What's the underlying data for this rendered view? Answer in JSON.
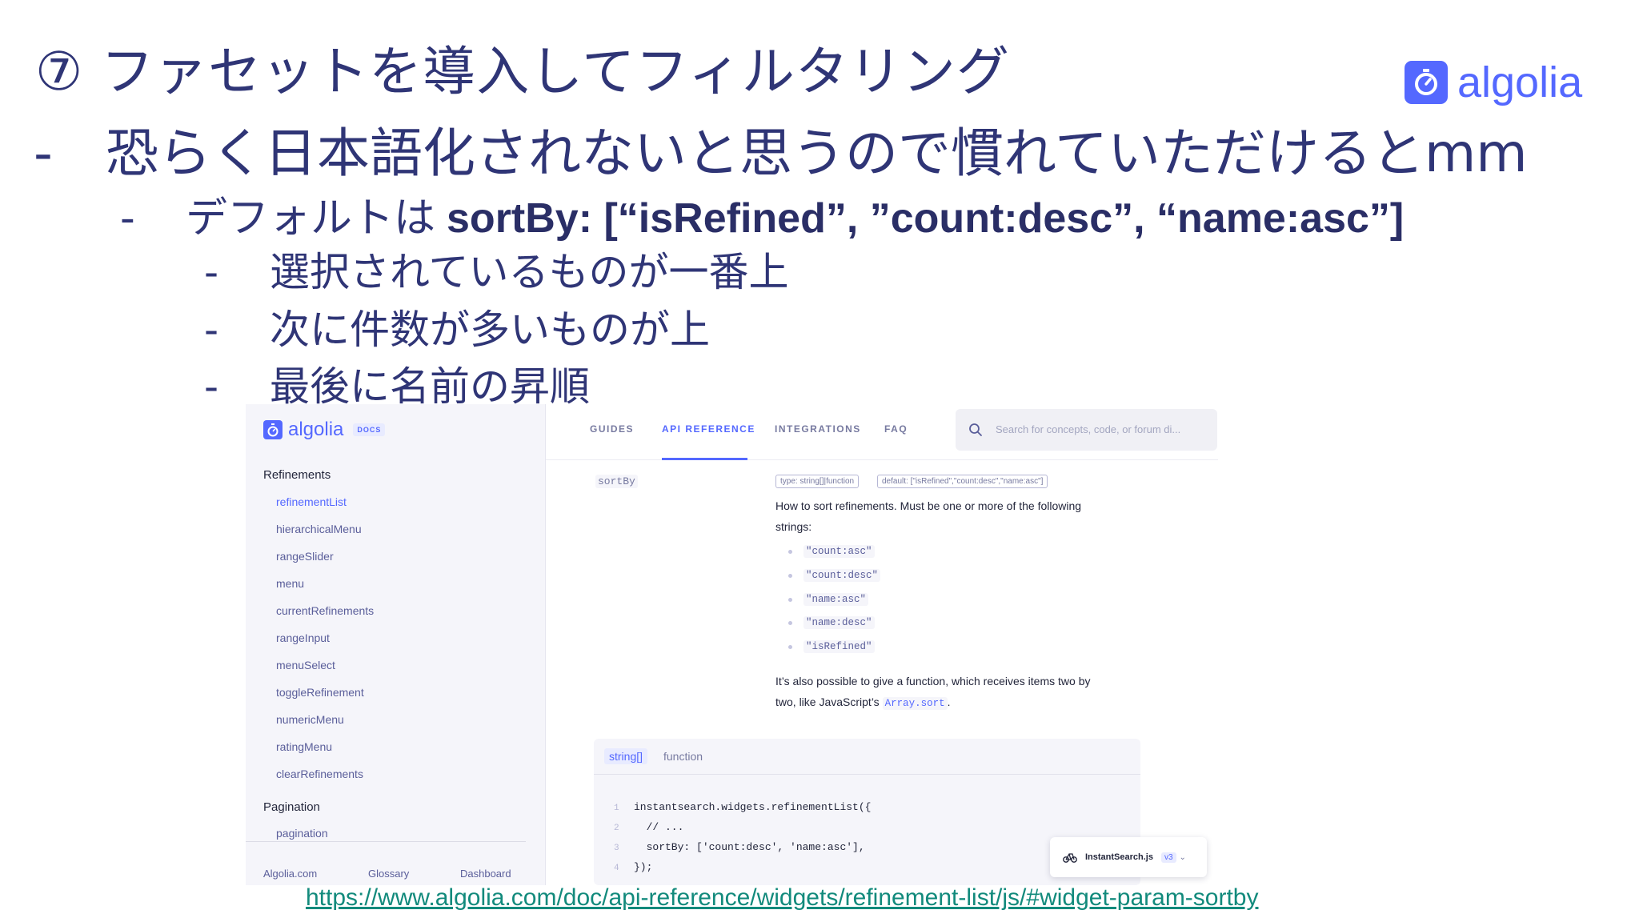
{
  "slide": {
    "title": "⑦ ファセットを導入してフィルタリング",
    "bullets": [
      {
        "dash": "-",
        "text": "恐らく日本語化されないと思うので慣れていただけるとmm"
      },
      {
        "dash": "-",
        "text": "デフォルトは",
        "strong": "sortBy: [“isRefined”, ”count:desc”, “name:asc”]"
      },
      {
        "dash": "-",
        "text": "選択されているものが一番上"
      },
      {
        "dash": "-",
        "text": "次に件数が多いものが上"
      },
      {
        "dash": "-",
        "text": "最後に名前の昇順"
      }
    ],
    "logo_text": "algolia",
    "link_url": "https://www.algolia.com/doc/api-reference/widgets/refinement-list/js/#widget-param-sortby"
  },
  "docs": {
    "logo_text": "algolia",
    "docs_badge": "DOCS",
    "sidebar": {
      "heading_refinements": "Refinements",
      "items": [
        "refinementList",
        "hierarchicalMenu",
        "rangeSlider",
        "menu",
        "currentRefinements",
        "rangeInput",
        "menuSelect",
        "toggleRefinement",
        "numericMenu",
        "ratingMenu",
        "clearRefinements"
      ],
      "heading_pagination": "Pagination",
      "pagination_item": "pagination",
      "footer": [
        "Algolia.com",
        "Glossary",
        "Dashboard"
      ]
    },
    "nav": {
      "tabs": [
        "GUIDES",
        "API REFERENCE",
        "INTEGRATIONS",
        "FAQ"
      ],
      "search_placeholder": "Search for concepts, code, or forum di..."
    },
    "param": {
      "name": "sortBy",
      "type_tag": "type: string[]|function",
      "default_tag": "default: [\"isRefined\",\"count:desc\",\"name:asc\"]",
      "desc_line1": "How to sort refinements. Must be one or more of the following",
      "desc_line2": "strings:",
      "options": [
        "\"count:asc\"",
        "\"count:desc\"",
        "\"name:asc\"",
        "\"name:desc\"",
        "\"isRefined\""
      ],
      "note_line1": "It’s also possible to give a function, which receives items two by",
      "note_line2_prefix": "two, like JavaScript’s",
      "note_code": "Array.sort",
      "note_suffix": "."
    },
    "code": {
      "tabs": [
        "string[]",
        "function"
      ],
      "lines": [
        {
          "n": "1",
          "text": "instantsearch.widgets.refinementList({"
        },
        {
          "n": "2",
          "text": "  // ..."
        },
        {
          "n": "3",
          "text": "  sortBy: ['count:desc', 'name:asc'],"
        },
        {
          "n": "4",
          "text": "});"
        }
      ]
    },
    "version_pill": {
      "name": "InstantSearch.js",
      "version": "v3"
    }
  },
  "colors": {
    "brand": "#5468ff",
    "title": "#2f3576",
    "link": "#128a7c"
  }
}
